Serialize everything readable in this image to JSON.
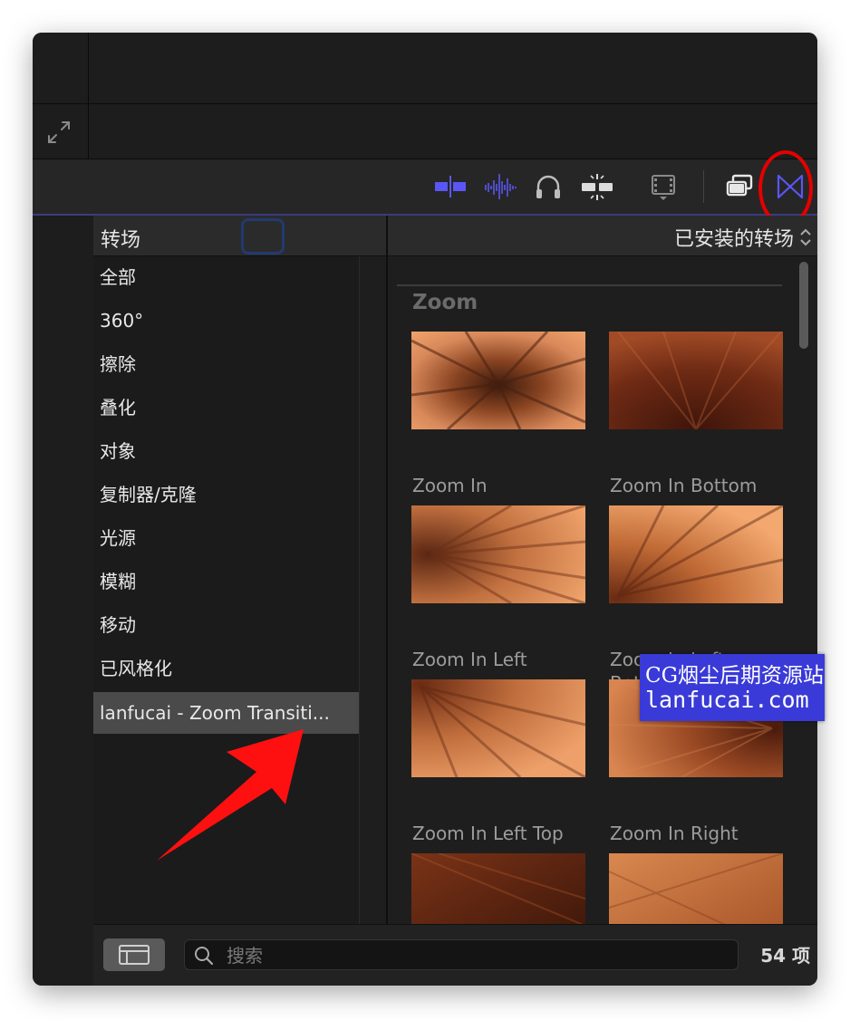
{
  "browser": {
    "header": {
      "title": "转场",
      "library": "已安装的转场"
    },
    "categories": [
      {
        "label": "全部"
      },
      {
        "label": "360°"
      },
      {
        "label": "擦除"
      },
      {
        "label": "叠化"
      },
      {
        "label": "对象"
      },
      {
        "label": "复制器/克隆"
      },
      {
        "label": "光源"
      },
      {
        "label": "模糊"
      },
      {
        "label": "移动"
      },
      {
        "label": "已风格化"
      },
      {
        "label": "lanfucai - Zoom Transiti..."
      }
    ],
    "selected_category_index": 10,
    "section": "Zoom",
    "items": [
      {
        "label": "Zoom In"
      },
      {
        "label": "Zoom In Bottom"
      },
      {
        "label": "Zoom In Left"
      },
      {
        "label": "Zoom In Left Bottom"
      },
      {
        "label": "Zoom In Left Top"
      },
      {
        "label": "Zoom In Right"
      }
    ]
  },
  "search": {
    "placeholder": "搜索"
  },
  "footer": {
    "count": "54 项"
  },
  "watermark": {
    "line1": "CG烟尘后期资源站",
    "line2": "lanfucai.com"
  },
  "colors": {
    "accent": "#5a56f5",
    "annotation": "#e50000",
    "watermark_bg": "#3a3ad8",
    "selection": "#4a4a4a"
  },
  "icons": [
    "expand-icon",
    "clip-trim-icon",
    "audio-waveform-icon",
    "headphones-icon",
    "skimming-icon",
    "filmstrip-icon",
    "clip-appearance-icon",
    "transitions-icon",
    "search-icon",
    "layout-icon",
    "chevron-updown-icon"
  ]
}
